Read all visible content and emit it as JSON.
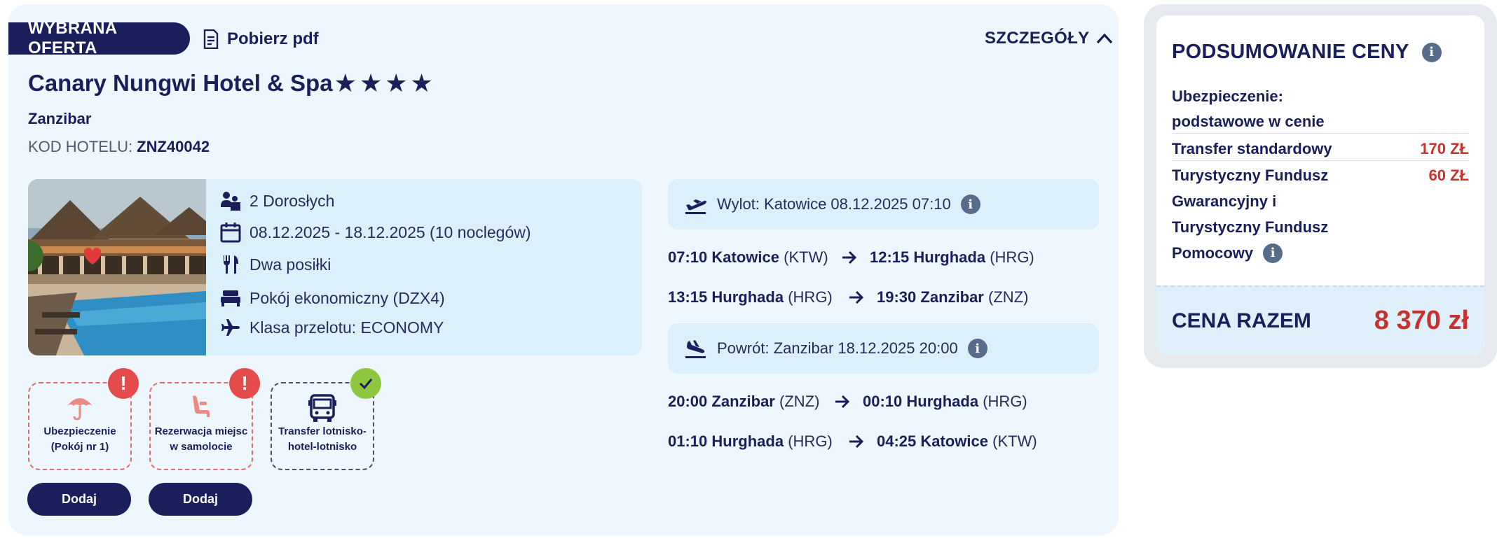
{
  "offer": {
    "badge": "WYBRANA OFERTA",
    "pdf_label": "Pobierz pdf",
    "details_label": "SZCZEGÓŁY",
    "hotel_name": "Canary Nungwi Hotel & Spa",
    "stars": 4,
    "destination": "Zanzibar",
    "hotel_code_label": "KOD HOTELU:",
    "hotel_code": "ZNZ40042"
  },
  "info": {
    "travellers": "2 Dorosłych",
    "dates": "08.12.2025 - 18.12.2025 (10 noclegów)",
    "board": "Dwa posiłki",
    "room": "Pokój ekonomiczny (DZX4)",
    "flight_class": "Klasa przelotu: ECONOMY"
  },
  "extras": [
    {
      "label_line1": "Ubezpieczenie",
      "label_line2": "(Pokój nr 1)",
      "status": "!",
      "button": "Dodaj"
    },
    {
      "label_line1": "Rezerwacja miejsc",
      "label_line2": "w samolocie",
      "status": "!",
      "button": "Dodaj"
    },
    {
      "label_line1": "Transfer lotnisko-",
      "label_line2": "hotel-lotnisko",
      "status": "✓"
    }
  ],
  "departure": {
    "header": "Wylot: Katowice 08.12.2025 07:10",
    "segments": [
      {
        "from_time": "07:10",
        "from_city": "Katowice",
        "from_code": "(KTW)",
        "to_time": "12:15",
        "to_city": "Hurghada",
        "to_code": "(HRG)"
      },
      {
        "from_time": "13:15",
        "from_city": "Hurghada",
        "from_code": "(HRG)",
        "to_time": "19:30",
        "to_city": "Zanzibar",
        "to_code": "(ZNZ)"
      }
    ]
  },
  "return": {
    "header": "Powrót: Zanzibar 18.12.2025 20:00",
    "segments": [
      {
        "from_time": "20:00",
        "from_city": "Zanzibar",
        "from_code": "(ZNZ)",
        "to_time": "00:10",
        "to_city": "Hurghada",
        "to_code": "(HRG)"
      },
      {
        "from_time": "01:10",
        "from_city": "Hurghada",
        "from_code": "(HRG)",
        "to_time": "04:25",
        "to_city": "Katowice",
        "to_code": "(KTW)"
      }
    ]
  },
  "summary": {
    "title": "PODSUMOWANIE CENY",
    "insurance_line1": "Ubezpieczenie:",
    "insurance_line2": "podstawowe w cenie",
    "transfer_label": "Transfer standardowy",
    "transfer_price": "170 ZŁ",
    "fund_line1": "Turystyczny Fundusz",
    "fund_line2": "Gwarancyjny i",
    "fund_line3": "Turystyczny Fundusz",
    "fund_line4": "Pomocowy",
    "fund_price": "60 ZŁ",
    "total_label": "CENA RAZEM",
    "total_price": "8 370 zł"
  },
  "colors": {
    "navy": "#1a1f5c",
    "price_red": "#c8322e",
    "alert_red": "#e54b4b",
    "ok_green": "#8dc63f",
    "panel_bg": "#eef7fd",
    "box_bg": "#dcf0fc"
  }
}
